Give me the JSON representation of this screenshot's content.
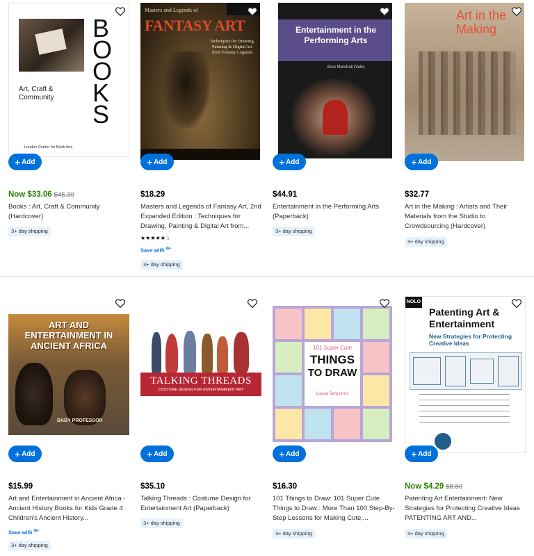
{
  "add_label": "Add",
  "products": [
    {
      "now_label": "Now $33.06",
      "was": "$45.30",
      "title": "Books : Art, Craft & Community (Hardcover)",
      "shipping": "3+ day shipping",
      "cover": {
        "title": "BOOKS",
        "subtitle": "Art, Craft & Community",
        "publisher": "London Center for Book Arts"
      }
    },
    {
      "price": "$18.29",
      "title": "Masters and Legends of Fantasy Art, 2nd Expanded Edition : Techniques for Drawing, Painting & Digital Art from...",
      "rating_stars": "★★★★★",
      "rating_count": "1",
      "save_with": "Save with",
      "save_plus": "W+",
      "shipping": "3+ day shipping",
      "cover": {
        "title": "FANTASY ART",
        "header": "Masters and Legends of",
        "tagline": "Techniques for Drawing, Painting & Digital Art from Fantasy Legends"
      }
    },
    {
      "price": "$44.91",
      "title": "Entertainment in the Performing Arts (Paperback)",
      "shipping": "3+ day shipping",
      "cover": {
        "title": "Entertainment in the Performing Arts",
        "author": "Alice Marshall (Valo)"
      }
    },
    {
      "price": "$32.77",
      "title": "Art in the Making : Artists and Their Materials from the Studio to Crowdsourcing (Hardcover)",
      "shipping": "3+ day shipping",
      "cover": {
        "title": "Art in the Making"
      }
    },
    {
      "price": "$15.99",
      "title": "Art and Entertainment in Ancient Africa - Ancient History Books for Kids Grade 4 Children's Ancient History...",
      "save_with": "Save with",
      "save_plus": "W+",
      "shipping": "3+ day shipping",
      "cover": {
        "title": "ART AND ENTERTAINMENT IN ANCIENT AFRICA",
        "author": "BABY PROFESSOR"
      }
    },
    {
      "price": "$35.10",
      "title": "Talking Threads : Costume Design for Entertainment Art (Paperback)",
      "shipping": "3+ day shipping",
      "cover": {
        "title": "TALKING THREADS",
        "subtitle": "COSTUME DESIGN FOR ENTERTAINMENT ART"
      }
    },
    {
      "price": "$16.30",
      "title": "101 Things to Draw: 101 Super Cute Things to Draw : More Than 100 Step-By-Step Lessons for Making Cute,...",
      "shipping": "3+ day shipping",
      "cover": {
        "title_top": "101 Super Cute",
        "title_main_1": "THINGS",
        "title_main_2": "TO DRAW",
        "author": "Louise Bergstrom"
      }
    },
    {
      "now_label": "Now $4.29",
      "was": "$8.80",
      "title": "Patenting Art Entertainment: New Strategies for Protecting Creative Ideas PATENTING ART AND...",
      "shipping": "3+ day shipping",
      "cover": {
        "logo": "NOLO",
        "title_1": "Patenting Art &",
        "title_2": "Entertainment",
        "subtitle": "New Strategies for Protecting Creative Ideas"
      }
    }
  ]
}
